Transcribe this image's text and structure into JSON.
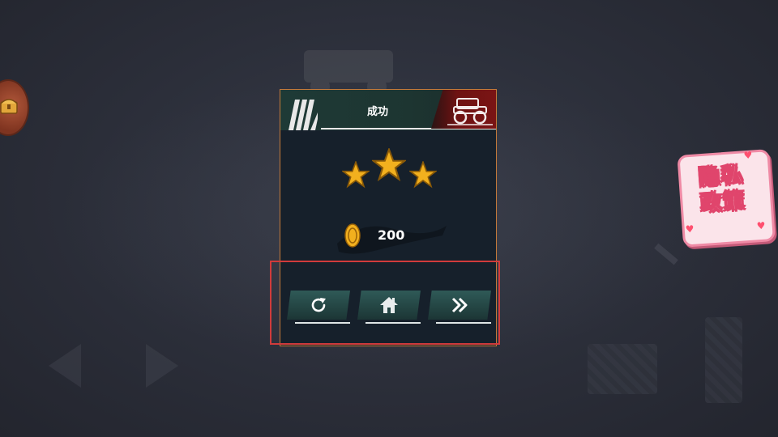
{
  "dialog": {
    "title": "成功",
    "stars_earned": 3,
    "stars_total": 3,
    "reward": {
      "icon": "coin-icon",
      "amount": "200"
    },
    "actions": [
      {
        "name": "restart-button",
        "icon": "restart-icon"
      },
      {
        "name": "home-button",
        "icon": "home-icon"
      },
      {
        "name": "next-level-button",
        "icon": "fast-forward-icon"
      }
    ]
  },
  "privacy": {
    "label": "隐私\n政策"
  },
  "side_buttons": {
    "left_icon": "treasure-chest-icon"
  },
  "colors": {
    "dialog_bg": "#16202b",
    "dialog_border": "#c47a3a",
    "header_green": "#1e3a36",
    "badge_red": "#7a1414",
    "star_gold": "#f2b01e",
    "highlight_red": "#d13b3b",
    "privacy_pink": "#e0456c"
  }
}
